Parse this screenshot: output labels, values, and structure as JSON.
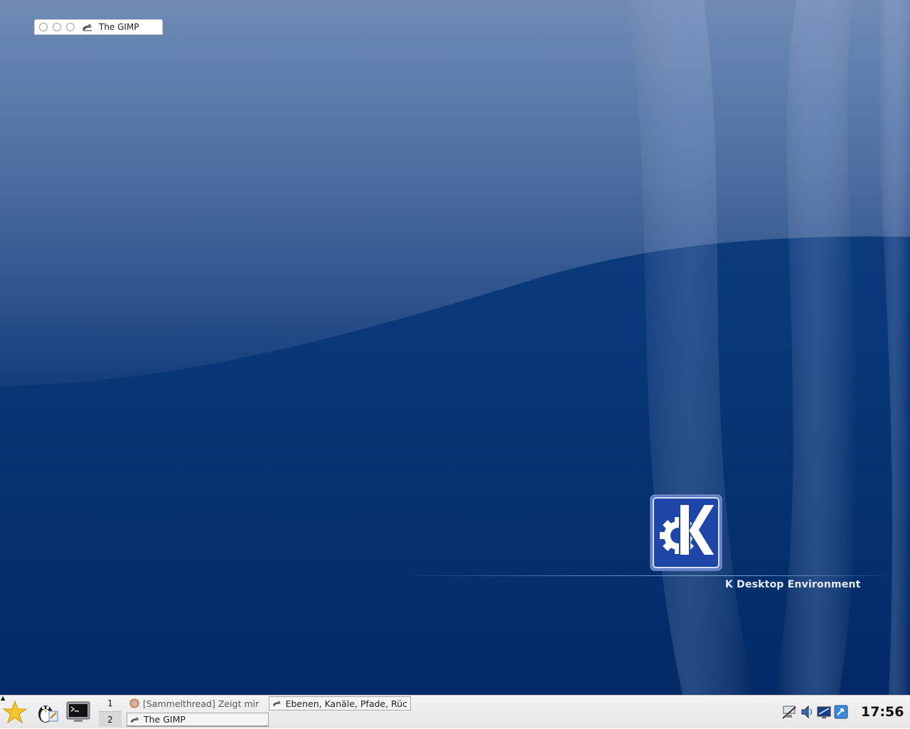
{
  "desktop": {
    "tagline": "K Desktop Environment",
    "colors": {
      "sky_top": "#6f8bb6",
      "deep_blue": "#043070",
      "logo_blue": "#1e45a8"
    }
  },
  "mini_window": {
    "title": "The GIMP",
    "icon": "gimp-icon"
  },
  "taskbar": {
    "launchers": [
      {
        "name": "kmenu-star-icon"
      },
      {
        "name": "konqueror-tux-icon"
      },
      {
        "name": "terminal-icon"
      }
    ],
    "pager": [
      "1",
      "2"
    ],
    "active_desktop": "2",
    "tasks": [
      {
        "label": "[Sammelthread] Zeigt mir",
        "icon": "firefox-icon"
      },
      {
        "label": "Ebenen, Kanäle, Pfade, Rüc",
        "icon": "gimp-icon"
      },
      {
        "label": "The GIMP",
        "icon": "gimp-icon"
      }
    ],
    "tray": [
      "network-icon",
      "volume-icon",
      "display-icon",
      "klipper-icon"
    ],
    "clock": "17:56"
  }
}
